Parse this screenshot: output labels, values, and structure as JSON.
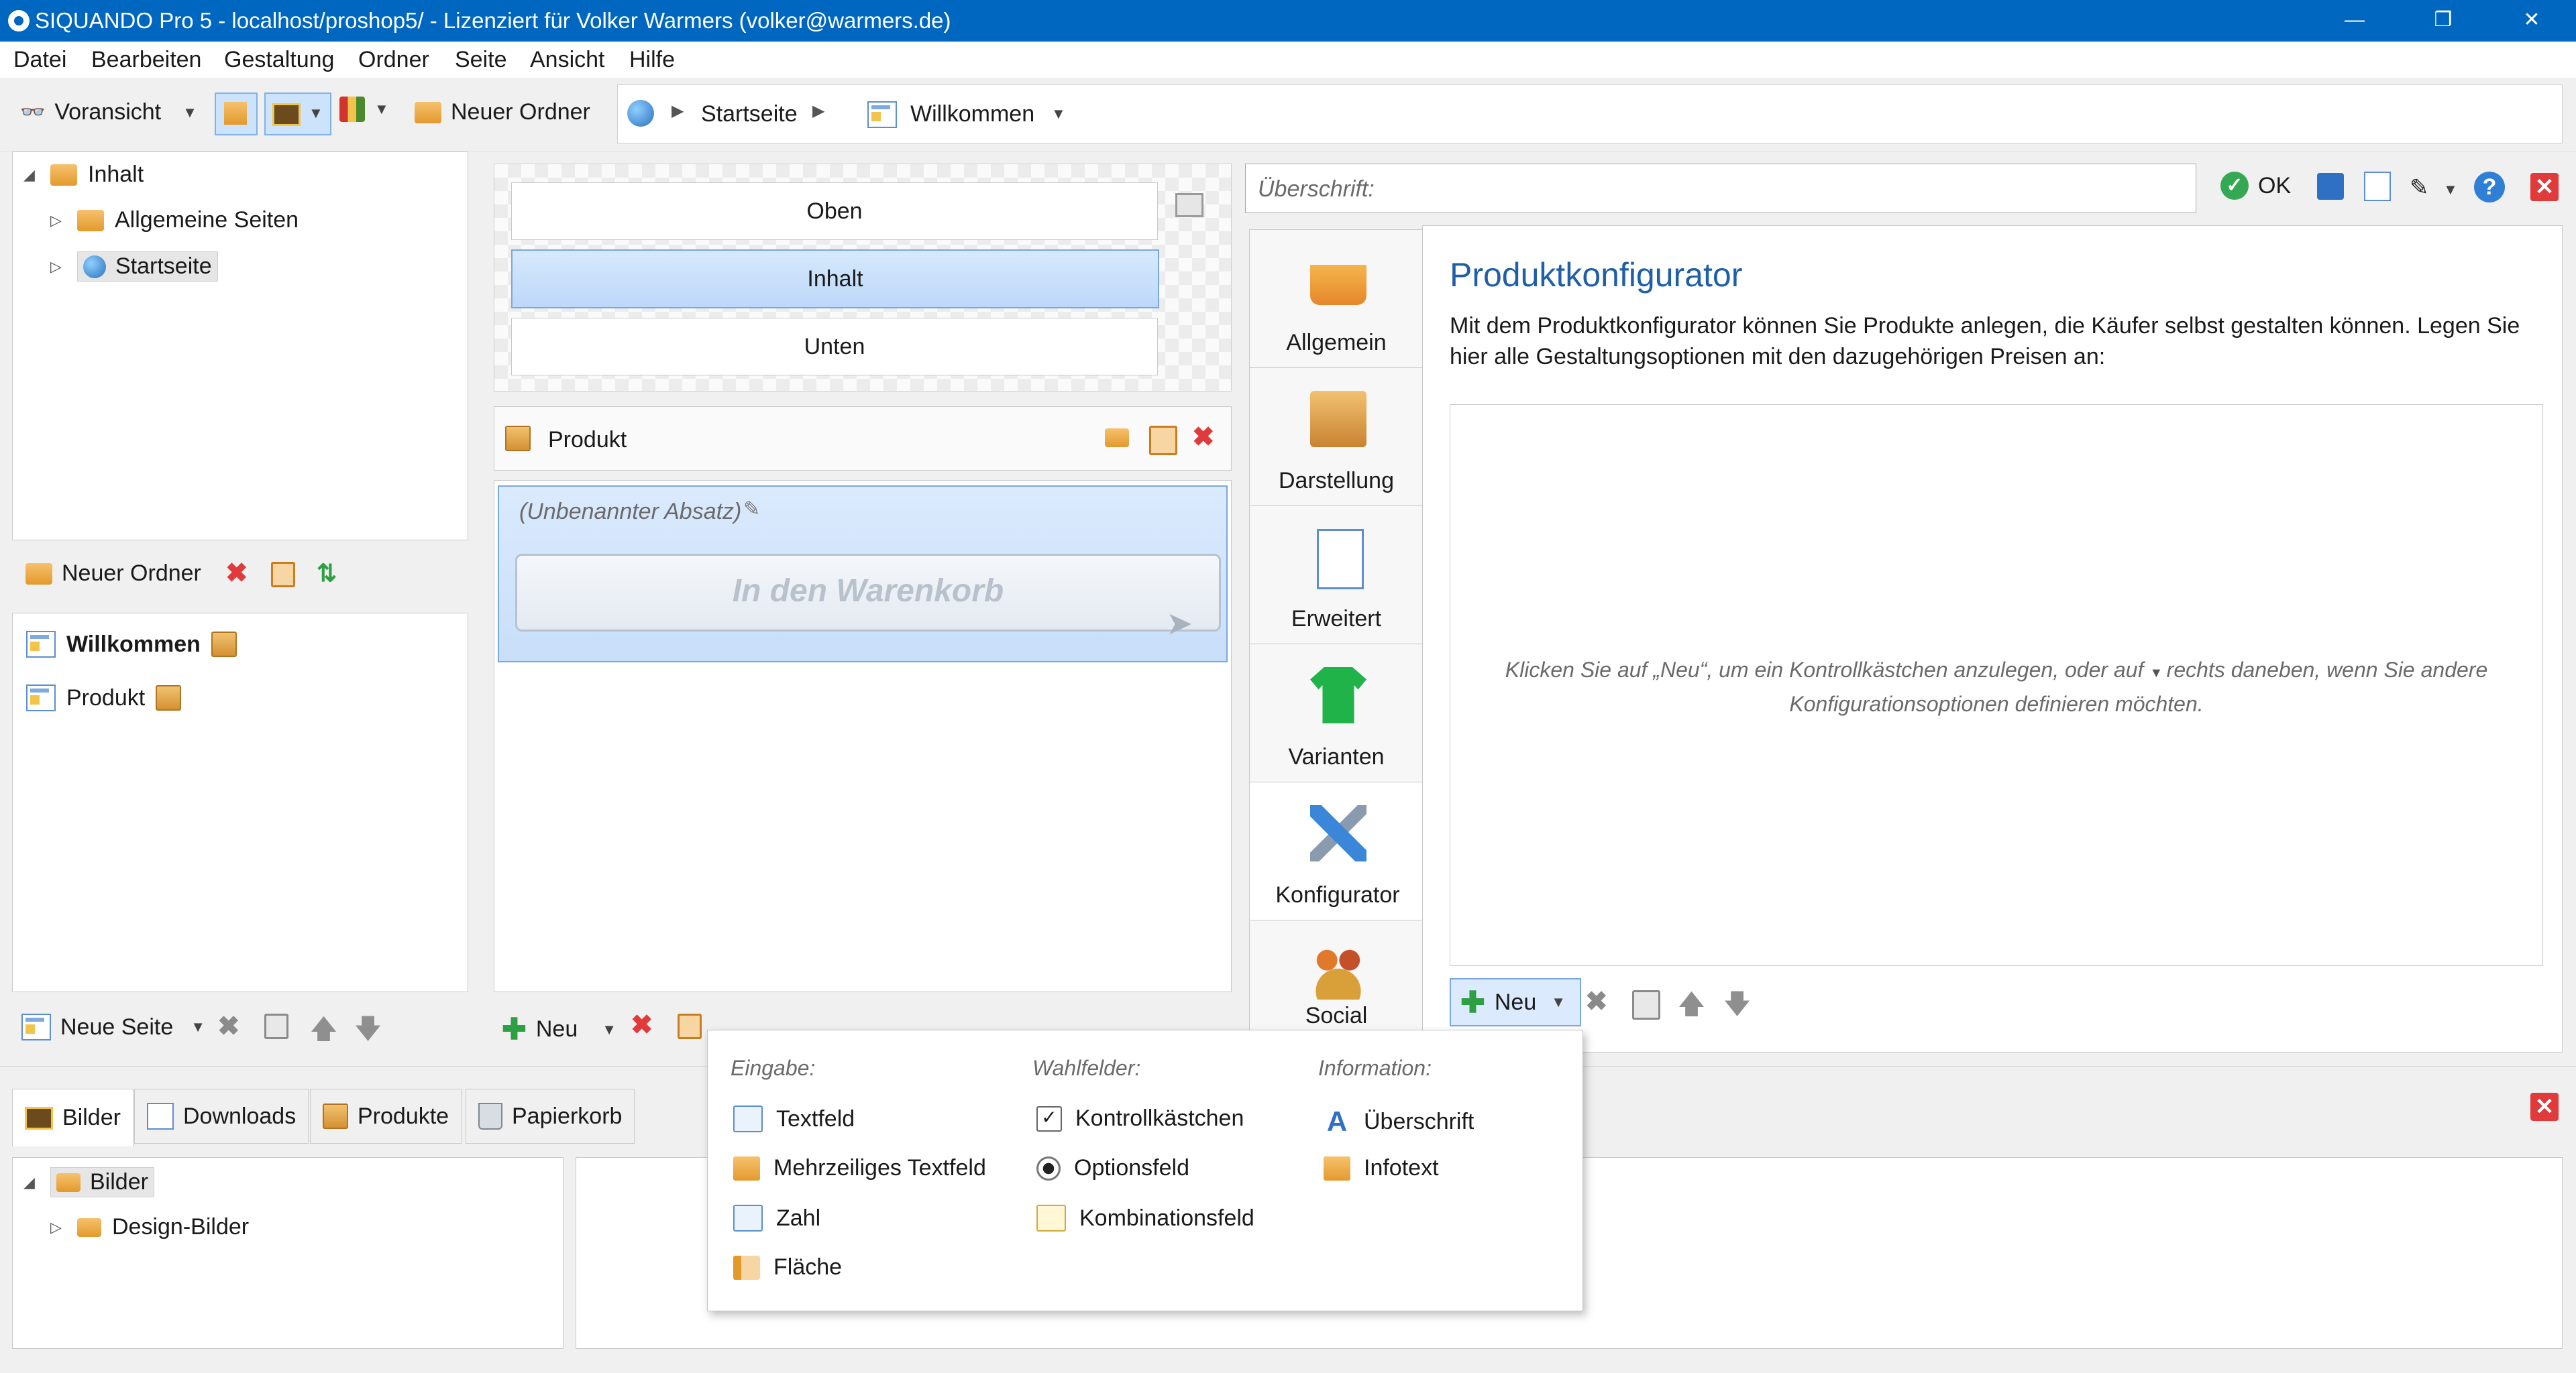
{
  "window": {
    "title": "SIQUANDO Pro 5 - localhost/proshop5/ - Lizenziert für Volker Warmers (volker@warmers.de)",
    "controls": [
      "—",
      "❐",
      "✕"
    ]
  },
  "menu": [
    "Datei",
    "Bearbeiten",
    "Gestaltung",
    "Ordner",
    "Seite",
    "Ansicht",
    "Hilfe"
  ],
  "toolbar": {
    "preview_label": "Voransicht",
    "new_folder_label": "Neuer Ordner"
  },
  "breadcrumb": [
    "Startseite",
    "Willkommen"
  ],
  "folder_tree": {
    "root": "Inhalt",
    "children": [
      "Allgemeine Seiten",
      "Startseite"
    ]
  },
  "folder_actions": {
    "new_folder_label": "Neuer Ordner"
  },
  "page_list": [
    "Willkommen",
    "Produkt"
  ],
  "page_actions": {
    "new_page_label": "Neue Seite"
  },
  "layout_sections": [
    "Oben",
    "Inhalt",
    "Unten"
  ],
  "product_block": {
    "title": "Produkt",
    "paragraph_label": "(Unbenannter Absatz)",
    "cart_button": "In den Warenkorb"
  },
  "middle_actions": {
    "new_label": "Neu"
  },
  "heading_field": {
    "placeholder": "Überschrift:"
  },
  "top_actions": {
    "ok_label": "OK"
  },
  "side_tabs": [
    "Allgemein",
    "Darstellung",
    "Erweitert",
    "Varianten",
    "Konfigurator",
    "Social"
  ],
  "configurator": {
    "title": "Produktkonfigurator",
    "description": "Mit dem Produktkonfigurator können Sie Produkte anlegen, die Käufer selbst gestalten können. Legen Sie hier alle Gestaltungsoptionen mit den dazugehörigen Preisen an:",
    "empty_hint_1": "Klicken Sie auf „Neu“, um ein Kontrollkästchen anzulegen, oder auf",
    "empty_hint_1b": "rechts daneben, wenn Sie andere",
    "empty_hint_2": "Konfigurationsoptionen definieren möchten.",
    "new_label": "Neu"
  },
  "popup": {
    "input_heading": "Eingabe:",
    "input_items": [
      "Textfeld",
      "Mehrzeiliges Textfeld",
      "Zahl",
      "Fläche"
    ],
    "choice_heading": "Wahlfelder:",
    "choice_items": [
      "Kontrollkästchen",
      "Optionsfeld",
      "Kombinationsfeld"
    ],
    "info_heading": "Information:",
    "info_items": [
      "Überschrift",
      "Infotext"
    ]
  },
  "bottom_tabs": [
    "Bilder",
    "Downloads",
    "Produkte",
    "Papierkorb"
  ],
  "image_tree": {
    "root": "Bilder",
    "children": [
      "Design-Bilder"
    ]
  },
  "colors": {
    "titlebar": "#0067c0",
    "accent_blue": "#1e5fa8",
    "delete_red": "#e03a3a",
    "add_green": "#2ea043"
  }
}
